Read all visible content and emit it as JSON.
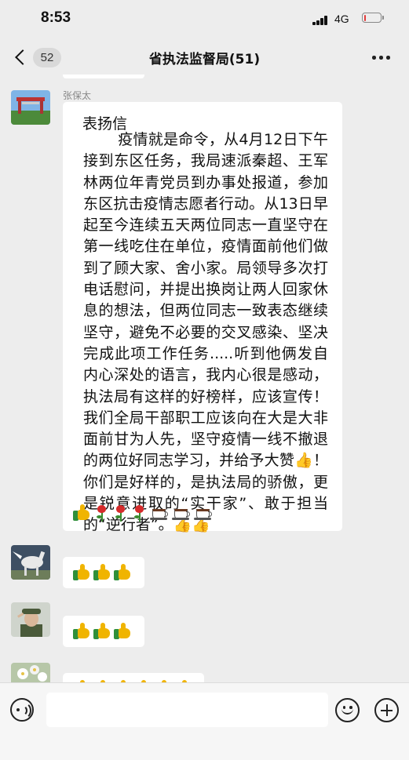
{
  "status_bar": {
    "time": "8:53",
    "network": "4G",
    "battery_percent": 10
  },
  "nav": {
    "unread_count": "52",
    "title": "省执法监督局(51)",
    "back_icon": "chevron-left-icon",
    "more_icon": "more-icon"
  },
  "messages": [
    {
      "sender": "张保太",
      "avatar_icon": "gate-photo-avatar",
      "title": "表扬信",
      "body": "       疫情就是命令，从4月12日下午接到东区任务，我局速派秦超、王军林两位年青党员到办事处报道，参加东区抗击疫情志愿者行动。从13日早起至今连续五天两位同志一直坚守在第一线吃住在单位，疫情面前他们做到了顾大家、舍小家。局领导多次打电话慰问，并提出换岗让两人回家休息的想法，但两位同志一致表态继续坚守，避免不必要的交叉感染、坚决完成此项工作任务.....听到他俩发自内心深处的语言，我内心很是感动，执法局有这样的好榜样，应该宣传！我们全局干部职工应该向在大是大非面前甘为人先，坚守疫情一线不撤退的两位好同志学习，并给予大赞👍！你们是好样的，是执法局的骄傲，更是锐意进取的“实干家”、敢于担当的“逆行者”。👍👍",
      "emoji_line": [
        "thumbs-up",
        "rose",
        "rose",
        "rose",
        "coffee",
        "coffee",
        "coffee"
      ]
    },
    {
      "avatar_icon": "horse-photo-avatar",
      "emoji_line": [
        "thumbs-up",
        "thumbs-up",
        "thumbs-up"
      ]
    },
    {
      "avatar_icon": "soldier-photo-avatar",
      "emoji_line": [
        "thumbs-up",
        "thumbs-up",
        "thumbs-up"
      ]
    },
    {
      "avatar_icon": "flower-photo-avatar",
      "emoji_line": [
        "thumbs-up",
        "thumbs-up",
        "thumbs-up",
        "thumbs-up",
        "thumbs-up",
        "thumbs-up"
      ]
    }
  ],
  "input_bar": {
    "voice_icon": "voice-icon",
    "input_value": "",
    "emoji_icon": "emoji-face-icon",
    "plus_icon": "plus-icon"
  },
  "colors": {
    "chat_background": "#ededed",
    "bubble": "#ffffff",
    "battery_low": "#e23b3b"
  }
}
